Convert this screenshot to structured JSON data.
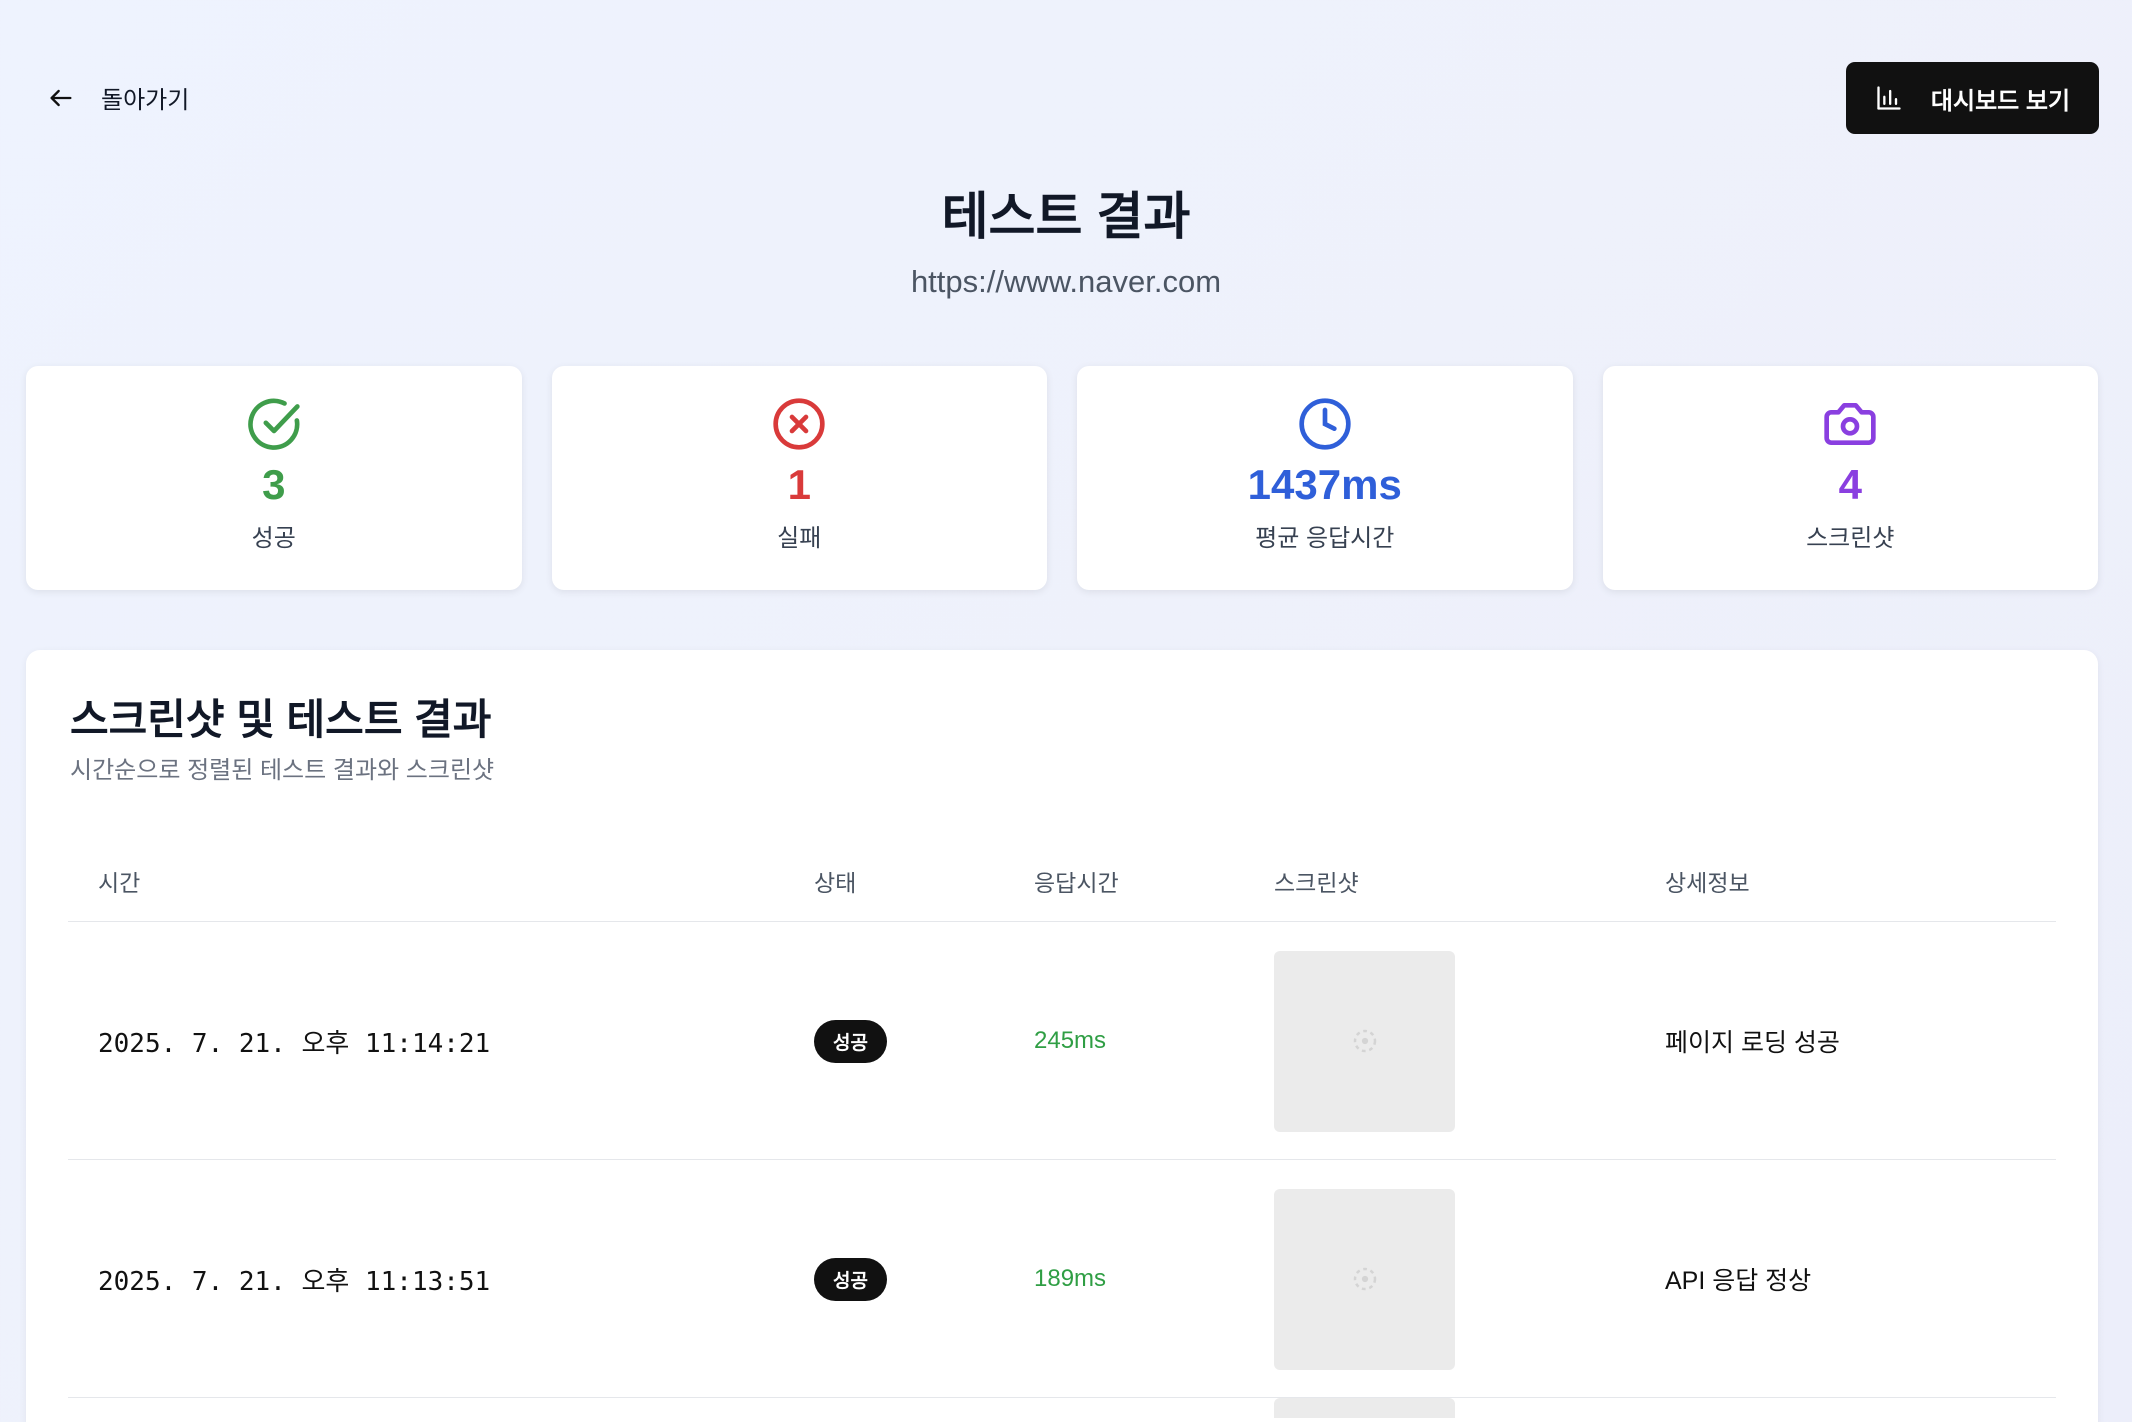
{
  "nav": {
    "back_label": "돌아가기",
    "dashboard_label": "대시보드 보기"
  },
  "header": {
    "title": "테스트 결과",
    "url": "https://www.naver.com"
  },
  "stats": [
    {
      "value": "3",
      "label": "성공",
      "color": "#3f9d4b",
      "icon": "check-circle-icon"
    },
    {
      "value": "1",
      "label": "실패",
      "color": "#d93a3a",
      "icon": "x-circle-icon"
    },
    {
      "value": "1437ms",
      "label": "평균 응답시간",
      "color": "#2f5fd9",
      "icon": "clock-icon"
    },
    {
      "value": "4",
      "label": "스크린샷",
      "color": "#8a3fe0",
      "icon": "camera-icon"
    }
  ],
  "results": {
    "title": "스크린샷 및 테스트 결과",
    "subtitle": "시간순으로 정렬된 테스트 결과와 스크린샷",
    "columns": [
      "시간",
      "상태",
      "응답시간",
      "스크린샷",
      "상세정보"
    ],
    "rows": [
      {
        "time": "2025. 7. 21. 오후 11:14:21",
        "status": "성공",
        "response_time": "245ms",
        "detail": "페이지 로딩 성공"
      },
      {
        "time": "2025. 7. 21. 오후 11:13:51",
        "status": "성공",
        "response_time": "189ms",
        "detail": "API 응답 정상"
      }
    ]
  }
}
